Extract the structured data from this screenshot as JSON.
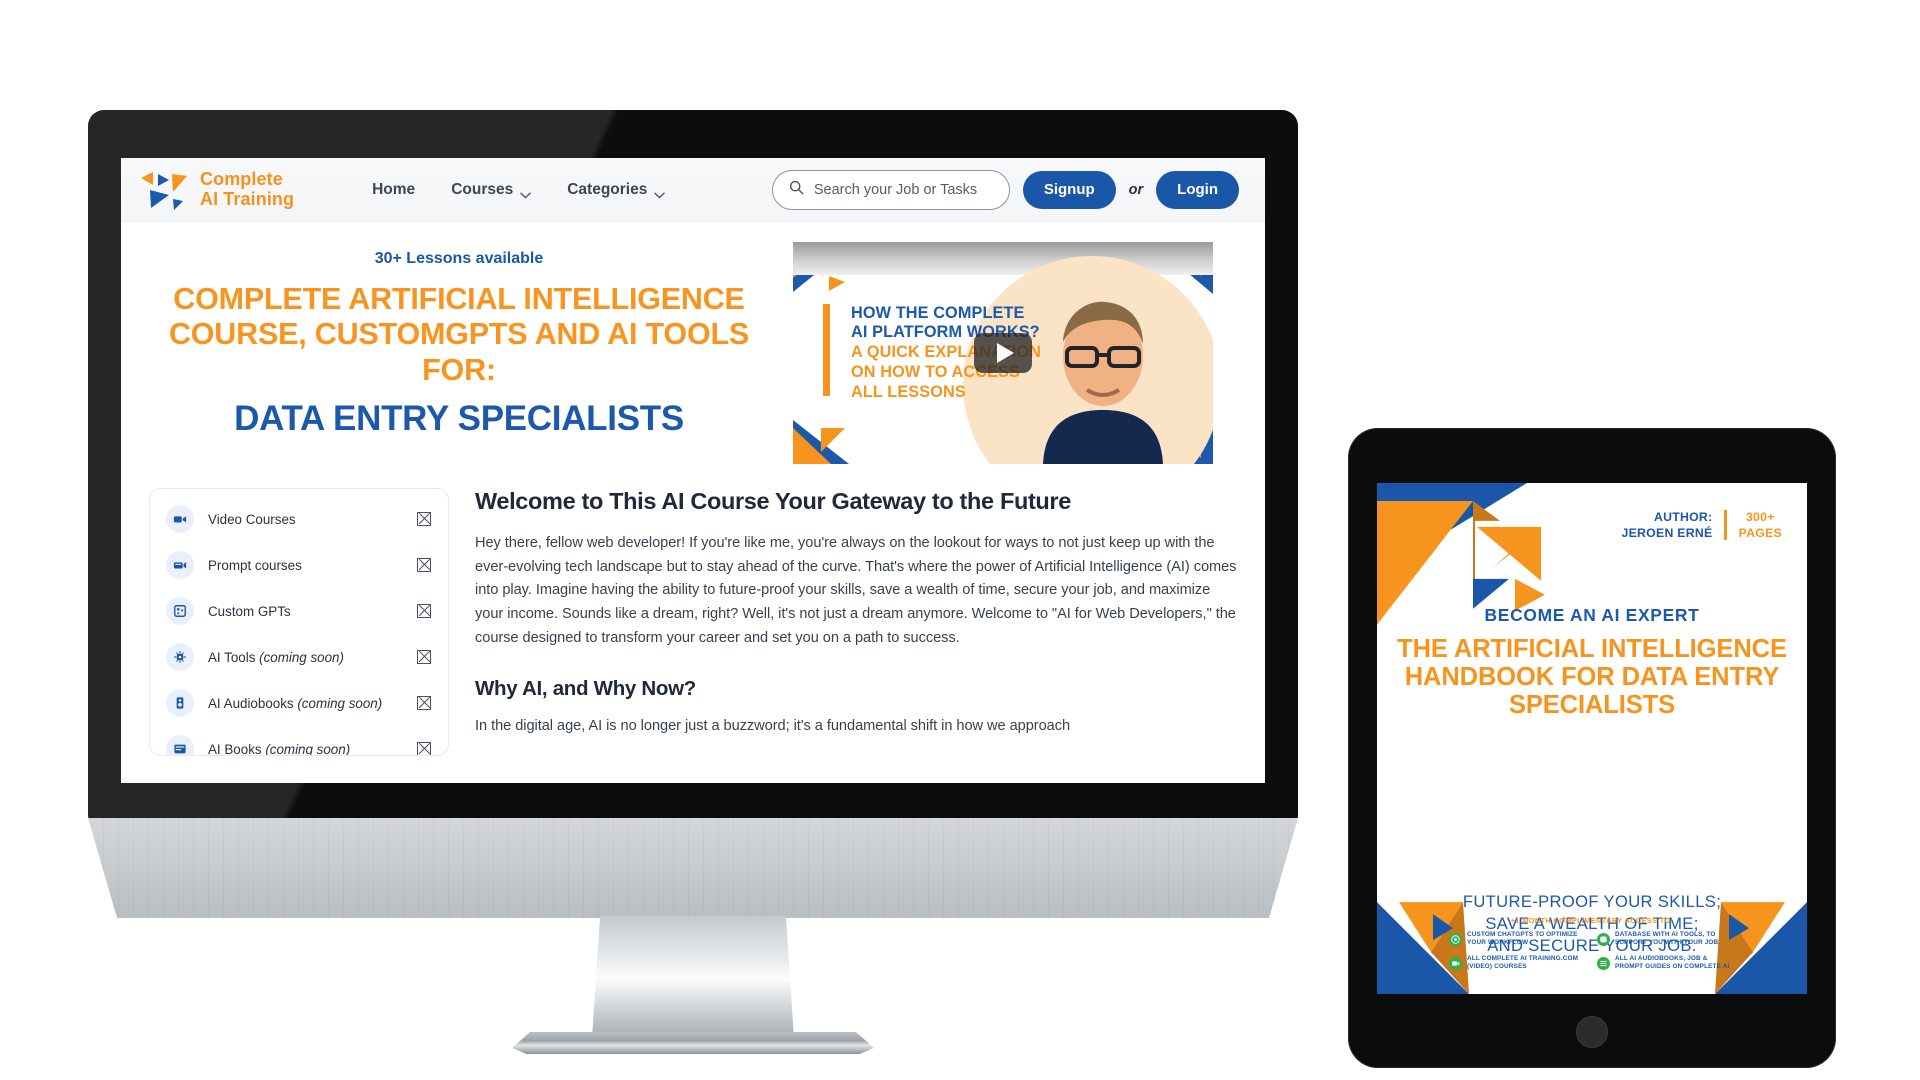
{
  "header": {
    "brand": {
      "line1": "Complete",
      "line2": "AI Training",
      "logo_icon": "triangles-logo-icon",
      "text": "Complete\nAI Training"
    },
    "nav": [
      {
        "label": "Home",
        "has_chevron": false
      },
      {
        "label": "Courses",
        "has_chevron": true
      },
      {
        "label": "Categories",
        "has_chevron": true
      }
    ],
    "search": {
      "placeholder": "Search your Job or Tasks",
      "icon": "search-icon",
      "value": ""
    },
    "signup_label": "Signup",
    "or_label": "or",
    "login_label": "Login"
  },
  "hero": {
    "lessons_badge": "30+ Lessons available",
    "headline_orange_line1": "COMPLETE ARTIFICIAL INTELLIGENCE",
    "headline_orange_line2": "COURSE, CUSTOMGPTS AND AI TOOLS FOR:",
    "headline_blue": "DATA ENTRY SPECIALISTS",
    "video": {
      "title_blue_line1": "HOW THE COMPLETE",
      "title_blue_line2": "AI PLATFORM WORKS?",
      "title_orange_line1": "A QUICK EXPLANATION",
      "title_orange_line2": "ON HOW TO ACCESS",
      "title_orange_line3": "ALL LESSONS",
      "play_icon": "play-button-icon"
    }
  },
  "courses": [
    {
      "label": "Video Courses",
      "suffix": "",
      "icon": "video-camera-icon"
    },
    {
      "label": "Prompt courses",
      "suffix": "",
      "icon": "prompt-terminal-icon"
    },
    {
      "label": "Custom GPTs",
      "suffix": "",
      "icon": "grid-dots-icon"
    },
    {
      "label": "AI Tools ",
      "suffix": "(coming soon)",
      "icon": "cpu-chip-icon"
    },
    {
      "label": "AI Audiobooks ",
      "suffix": "(coming soon)",
      "icon": "audiobook-speaker-icon"
    },
    {
      "label": "AI Books ",
      "suffix": "(coming soon)",
      "icon": "book-icon"
    }
  ],
  "article": {
    "h1": "Welcome to This AI Course Your Gateway to the Future",
    "p1": "Hey there, fellow web developer! If you're like me, you're always on the lookout for ways to not just keep up with the ever-evolving tech landscape but to stay ahead of the curve. That's where the power of Artificial Intelligence (AI) comes into play. Imagine having the ability to future-proof your skills, save a wealth of time, secure your job, and maximize your income. Sounds like a dream, right? Well, it's not just a dream anymore. Welcome to \"AI for Web Developers,\" the course designed to transform your career and set you on a path to success.",
    "h2": "Why AI, and Why Now?",
    "p2": "In the digital age, AI is no longer just a buzzword; it's a fundamental shift in how we approach"
  },
  "book_cover": {
    "author_label": "AUTHOR:",
    "author_name": "JEROEN ERNÉ",
    "pages_line1": "300+",
    "pages_line2": "PAGES",
    "kicker": "BECOME AN AI EXPERT",
    "title": "THE ARTIFICIAL INTELLIGENCE HANDBOOK FOR DATA ENTRY SPECIALISTS",
    "tagline_line1": "FUTURE-PROOF YOUR SKILLS;",
    "tagline_line2": "SAVE A WEALTH OF TIME;",
    "tagline_line3": "AND SECURE YOUR JOB.",
    "bonus_heading": "+1 MONTH COMPLIMENTARY ACCESS TO:",
    "bonus_items": [
      {
        "text": "CUSTOM CHATGPTS TO OPTIMIZE YOUR WORKFLOW",
        "icon": "chatgpt-badge-icon"
      },
      {
        "text": "DATABASE WITH AI TOOLS, TO SUPPORT YOU WITH YOUR JOB.",
        "icon": "database-badge-icon"
      },
      {
        "text": "ALL COMPLETE AI TRAINING.COM (VIDEO) COURSES",
        "icon": "video-badge-icon"
      },
      {
        "text": "ALL AI AUDIOBOOKS, JOB & PROMPT GUIDES ON COMPLETE AI",
        "icon": "audiobook-badge-icon"
      }
    ]
  },
  "colors": {
    "brand_orange": "#f7941d",
    "brand_blue": "#1c59ab",
    "button_blue": "#1b57a8",
    "bonus_green": "#2bb24a",
    "text_dark": "#20283a"
  }
}
